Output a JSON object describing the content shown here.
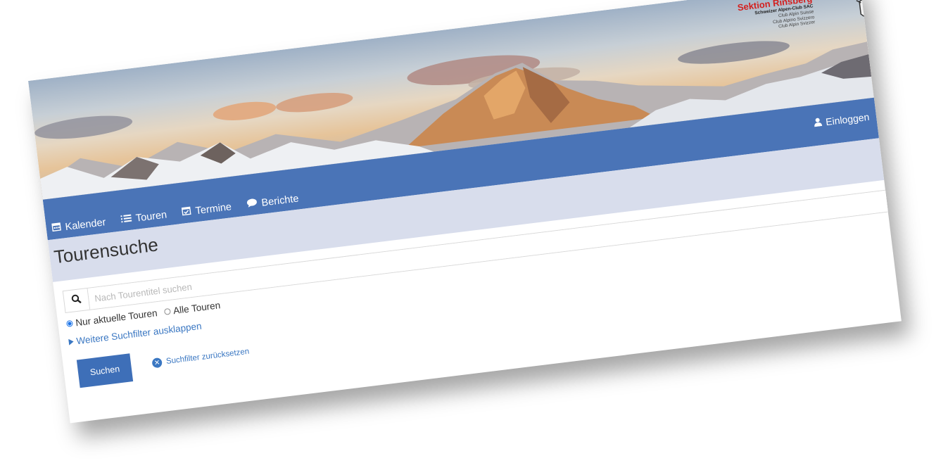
{
  "brand": {
    "title": "Sektion Rinsberg",
    "subtitle": "Schweizer Alpen-Club SAC",
    "lines": [
      "Club Alpin Suisse",
      "Club Alpino Svizzero",
      "Club Alpin Svizzer"
    ]
  },
  "header": {
    "login_label": "Einloggen"
  },
  "nav": {
    "items": [
      {
        "label": "Kalender",
        "icon": "calendar-icon"
      },
      {
        "label": "Touren",
        "icon": "list-icon"
      },
      {
        "label": "Termine",
        "icon": "calendar-check-icon"
      },
      {
        "label": "Berichte",
        "icon": "chat-bubble-icon"
      }
    ]
  },
  "page": {
    "title": "Tourensuche"
  },
  "search": {
    "placeholder": "Nach Tourentitel suchen",
    "value": ""
  },
  "filters": {
    "options": [
      {
        "label": "Nur aktuelle Touren",
        "checked": true
      },
      {
        "label": "Alle Touren",
        "checked": false
      }
    ],
    "more_label": "Weitere Suchfilter ausklappen"
  },
  "actions": {
    "submit_label": "Suchen",
    "reset_label": "Suchfilter zurücksetzen"
  },
  "colors": {
    "nav_blue": "#4a74b7",
    "band": "#d8ddec",
    "brand_red": "#d3201f",
    "link_blue": "#3a77c2"
  }
}
